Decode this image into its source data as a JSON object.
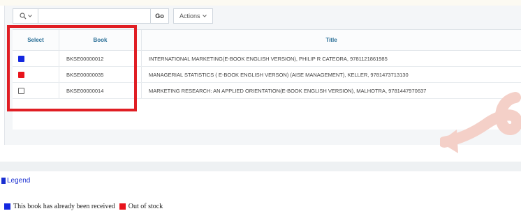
{
  "toolbar": {
    "go_label": "Go",
    "actions_label": "Actions",
    "search_value": ""
  },
  "grid": {
    "columns": [
      "Select",
      "Book",
      "Title"
    ],
    "rows": [
      {
        "marker": "blue",
        "book": "BKSE00000012",
        "title": "INTERNATIONAL MARKETING(E-BOOK ENGLISH VERSION), PHILIP R CATEORA, 9781121861985"
      },
      {
        "marker": "red",
        "book": "BKSE00000035",
        "title": "MANAGERIAL STATISTICS ( E-BOOK ENGLISH VERSON) (AISE MANAGEMENT), KELLER, 9781473713130"
      },
      {
        "marker": "checkbox",
        "book": "BKSE00000014",
        "title": "MARKETING RESEARCH: AN APPLIED ORIENTATION(E-BOOK ENGLISH VERSION), MALHOTRA, 9781447970637"
      }
    ]
  },
  "legend": {
    "title": "Legend",
    "received_label": "This book has already been received",
    "out_of_stock_label": "Out of stock"
  },
  "colors": {
    "received": "#1428e0",
    "out_of_stock": "#e8141c",
    "highlight": "#e01e24",
    "link": "#1a2fd1"
  }
}
